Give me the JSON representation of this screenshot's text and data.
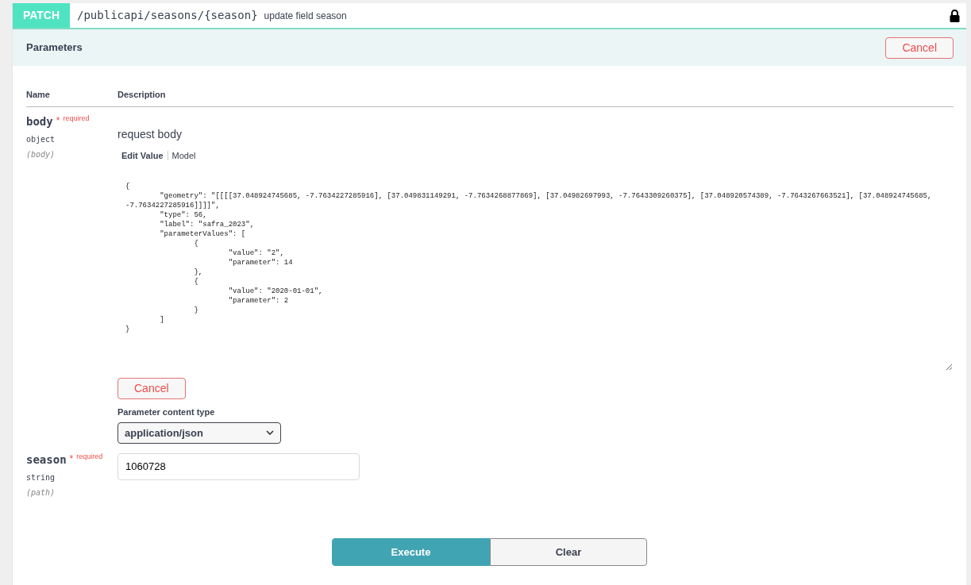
{
  "operation": {
    "method": "PATCH",
    "path": "/publicapi/seasons/{season}",
    "summary": "update field season",
    "locked": true
  },
  "parameters_bar": {
    "title": "Parameters",
    "cancel_button": "Cancel"
  },
  "table": {
    "columns": [
      "Name",
      "Description"
    ]
  },
  "body_param": {
    "name": "body",
    "required_mark": "*",
    "required_label": "required",
    "type": "object",
    "location": "(body)",
    "description": "request body",
    "tabs": [
      {
        "label": "Edit Value",
        "selected": true
      },
      {
        "label": "Model",
        "selected": false
      }
    ],
    "value": "{\n\t\"geometry\": \"[[[[37.048924745685, -7.7634227285916], [37.049831149291, -7.7634268877869], [37.04982697993, -7.7643309260375], [37.048920574389, -7.7643267663521], [37.048924745685, -7.7634227285916]]]]\",\n\t\"type\": 56,\n\t\"label\": \"safra_2023\",\n\t\"parameterValues\": [\n\t\t{\n\t\t\t\"value\": \"2\",\n\t\t\t\"parameter\": 14\n\t\t},\n\t\t{\n\t\t\t\"value\": \"2020-01-01\",\n\t\t\t\"parameter\": 2\n\t\t}\n\t]\n}",
    "cancel_button": "Cancel",
    "content_type_label": "Parameter content type",
    "content_type": "application/json"
  },
  "season_param": {
    "name": "season",
    "required_mark": "*",
    "required_label": "required",
    "type": "string",
    "location": "(path)",
    "value": "1060728"
  },
  "actions": [
    "Execute",
    "Clear"
  ]
}
